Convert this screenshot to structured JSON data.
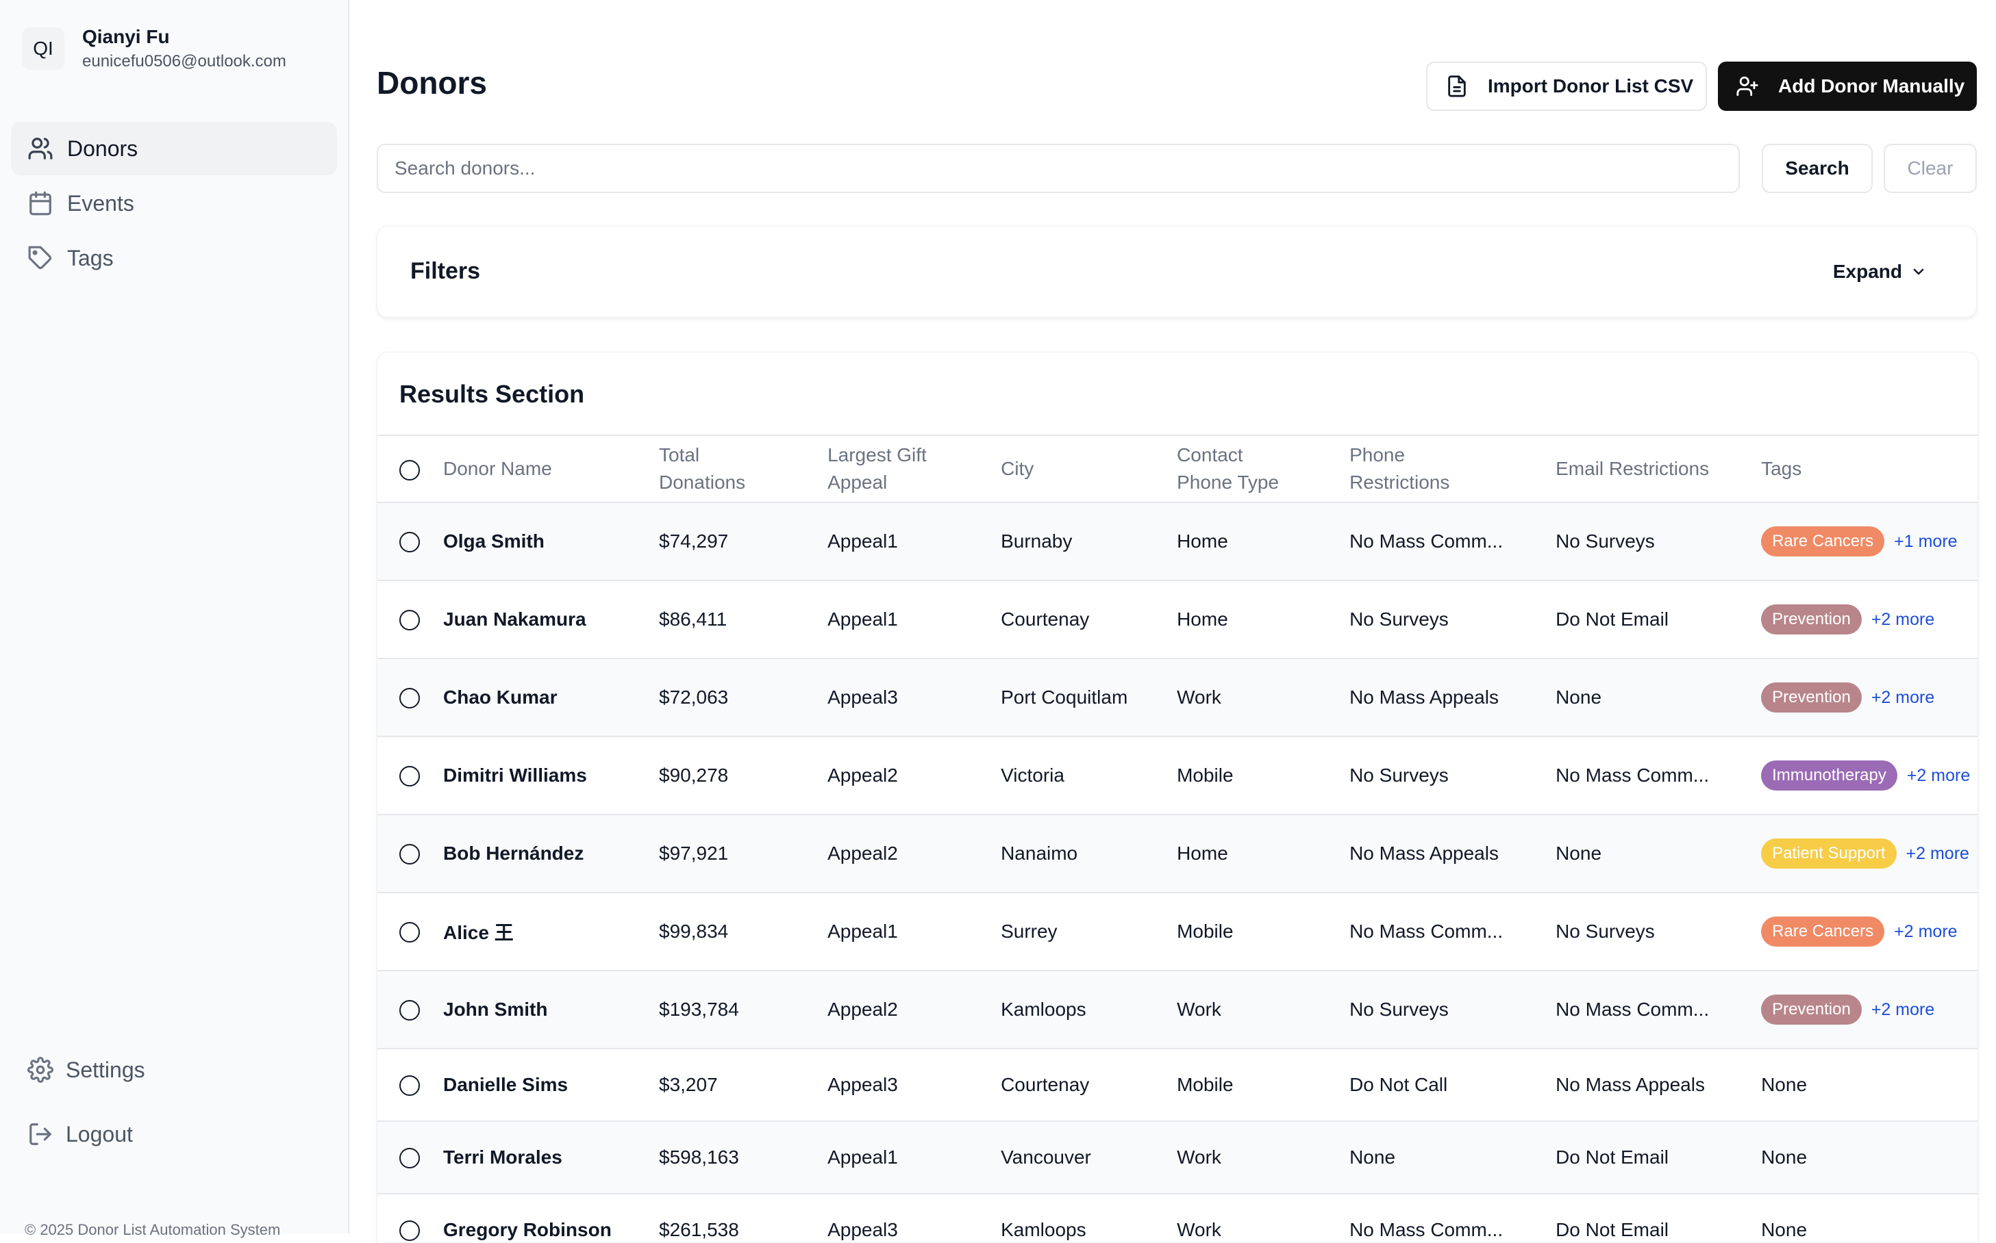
{
  "user": {
    "initials": "QI",
    "name": "Qianyi Fu",
    "email": "eunicefu0506@outlook.com"
  },
  "nav": [
    {
      "label": "Donors",
      "icon": "users-icon",
      "active": true
    },
    {
      "label": "Events",
      "icon": "calendar-icon",
      "active": false
    },
    {
      "label": "Tags",
      "icon": "tag-icon",
      "active": false
    }
  ],
  "bottom_nav": {
    "settings": "Settings",
    "logout": "Logout"
  },
  "copyright": "© 2025 Donor List Automation System",
  "page": {
    "title": "Donors"
  },
  "actions": {
    "import": "Import Donor List CSV",
    "add": "Add Donor Manually"
  },
  "search": {
    "placeholder": "Search donors...",
    "value": "",
    "search_label": "Search",
    "clear_label": "Clear"
  },
  "filters": {
    "title": "Filters",
    "expand_label": "Expand"
  },
  "results": {
    "title": "Results Section",
    "columns": [
      "Donor Name",
      "Total Donations",
      "Largest Gift Appeal",
      "City",
      "Contact Phone Type",
      "Phone Restrictions",
      "Email Restrictions",
      "Tags"
    ],
    "tag_colors": {
      "Rare Cancers": "#f08a65",
      "Prevention": "#b8868a",
      "Immunotherapy": "#9b6bb5",
      "Patient Support": "#f7cc47"
    },
    "rows": [
      {
        "name": "Olga Smith",
        "total": "$74,297",
        "appeal": "Appeal1",
        "city": "Burnaby",
        "phone_type": "Home",
        "phone_restrictions": "No Mass Comm...",
        "email_restrictions": "No Surveys",
        "tag": "Rare Cancers",
        "more": "+1 more"
      },
      {
        "name": "Juan Nakamura",
        "total": "$86,411",
        "appeal": "Appeal1",
        "city": "Courtenay",
        "phone_type": "Home",
        "phone_restrictions": "No Surveys",
        "email_restrictions": "Do Not Email",
        "tag": "Prevention",
        "more": "+2 more"
      },
      {
        "name": "Chao Kumar",
        "total": "$72,063",
        "appeal": "Appeal3",
        "city": "Port Coquitlam",
        "phone_type": "Work",
        "phone_restrictions": "No Mass Appeals",
        "email_restrictions": "None",
        "tag": "Prevention",
        "more": "+2 more"
      },
      {
        "name": "Dimitri Williams",
        "total": "$90,278",
        "appeal": "Appeal2",
        "city": "Victoria",
        "phone_type": "Mobile",
        "phone_restrictions": "No Surveys",
        "email_restrictions": "No Mass Comm...",
        "tag": "Immunotherapy",
        "more": "+2 more"
      },
      {
        "name": "Bob Hernández",
        "total": "$97,921",
        "appeal": "Appeal2",
        "city": "Nanaimo",
        "phone_type": "Home",
        "phone_restrictions": "No Mass Appeals",
        "email_restrictions": "None",
        "tag": "Patient Support",
        "more": "+2 more"
      },
      {
        "name": "Alice 王",
        "total": "$99,834",
        "appeal": "Appeal1",
        "city": "Surrey",
        "phone_type": "Mobile",
        "phone_restrictions": "No Mass Comm...",
        "email_restrictions": "No Surveys",
        "tag": "Rare Cancers",
        "more": "+2 more"
      },
      {
        "name": "John Smith",
        "total": "$193,784",
        "appeal": "Appeal2",
        "city": "Kamloops",
        "phone_type": "Work",
        "phone_restrictions": "No Surveys",
        "email_restrictions": "No Mass Comm...",
        "tag": "Prevention",
        "more": "+2 more"
      },
      {
        "name": "Danielle Sims",
        "total": "$3,207",
        "appeal": "Appeal3",
        "city": "Courtenay",
        "phone_type": "Mobile",
        "phone_restrictions": "Do Not Call",
        "email_restrictions": "No Mass Appeals",
        "tags_text": "None"
      },
      {
        "name": "Terri Morales",
        "total": "$598,163",
        "appeal": "Appeal1",
        "city": "Vancouver",
        "phone_type": "Work",
        "phone_restrictions": "None",
        "email_restrictions": "Do Not Email",
        "tags_text": "None"
      },
      {
        "name": "Gregory Robinson",
        "total": "$261,538",
        "appeal": "Appeal3",
        "city": "Kamloops",
        "phone_type": "Work",
        "phone_restrictions": "No Mass Comm...",
        "email_restrictions": "Do Not Email",
        "tags_text": "None"
      }
    ]
  }
}
